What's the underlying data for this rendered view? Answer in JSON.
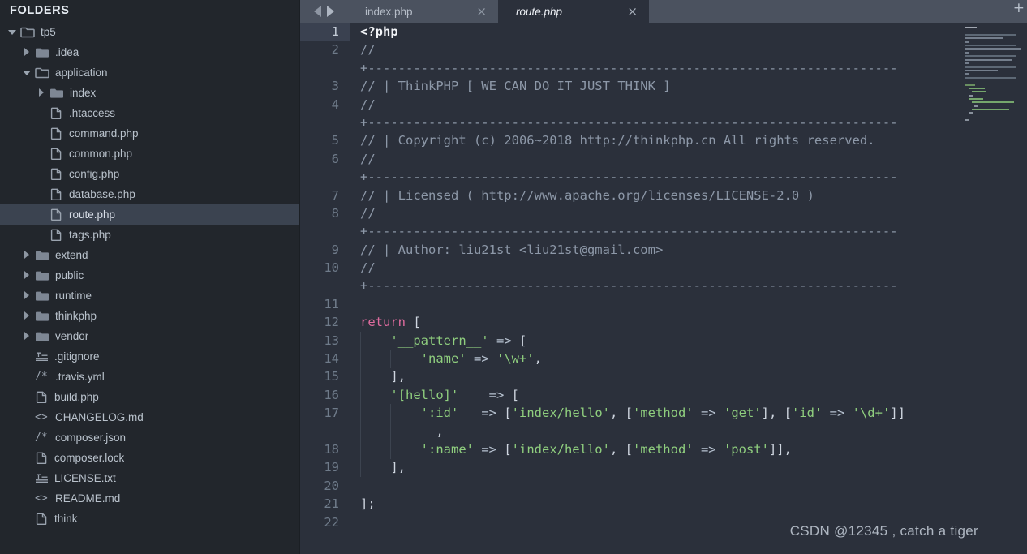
{
  "sidebar": {
    "title": "FOLDERS",
    "items": [
      {
        "label": "tp5",
        "depth": 0,
        "type": "folder-open",
        "state": "open",
        "selected": false
      },
      {
        "label": ".idea",
        "depth": 1,
        "type": "folder-closed",
        "state": "closed",
        "selected": false
      },
      {
        "label": "application",
        "depth": 1,
        "type": "folder-open",
        "state": "open",
        "selected": false
      },
      {
        "label": "index",
        "depth": 2,
        "type": "folder-closed",
        "state": "closed",
        "selected": false
      },
      {
        "label": ".htaccess",
        "depth": 2,
        "type": "file-doc",
        "state": "none",
        "selected": false
      },
      {
        "label": "command.php",
        "depth": 2,
        "type": "file-doc",
        "state": "none",
        "selected": false
      },
      {
        "label": "common.php",
        "depth": 2,
        "type": "file-doc",
        "state": "none",
        "selected": false
      },
      {
        "label": "config.php",
        "depth": 2,
        "type": "file-doc",
        "state": "none",
        "selected": false
      },
      {
        "label": "database.php",
        "depth": 2,
        "type": "file-doc",
        "state": "none",
        "selected": false
      },
      {
        "label": "route.php",
        "depth": 2,
        "type": "file-doc",
        "state": "none",
        "selected": true
      },
      {
        "label": "tags.php",
        "depth": 2,
        "type": "file-doc",
        "state": "none",
        "selected": false
      },
      {
        "label": "extend",
        "depth": 1,
        "type": "folder-closed",
        "state": "closed",
        "selected": false
      },
      {
        "label": "public",
        "depth": 1,
        "type": "folder-closed",
        "state": "closed",
        "selected": false
      },
      {
        "label": "runtime",
        "depth": 1,
        "type": "folder-closed",
        "state": "closed",
        "selected": false
      },
      {
        "label": "thinkphp",
        "depth": 1,
        "type": "folder-closed",
        "state": "closed",
        "selected": false
      },
      {
        "label": "vendor",
        "depth": 1,
        "type": "folder-closed",
        "state": "closed",
        "selected": false
      },
      {
        "label": ".gitignore",
        "depth": 1,
        "type": "file-text",
        "state": "none",
        "selected": false
      },
      {
        "label": ".travis.yml",
        "depth": 1,
        "type": "file-comment",
        "state": "none",
        "selected": false
      },
      {
        "label": "build.php",
        "depth": 1,
        "type": "file-doc",
        "state": "none",
        "selected": false
      },
      {
        "label": "CHANGELOG.md",
        "depth": 1,
        "type": "file-markup",
        "state": "none",
        "selected": false
      },
      {
        "label": "composer.json",
        "depth": 1,
        "type": "file-comment",
        "state": "none",
        "selected": false
      },
      {
        "label": "composer.lock",
        "depth": 1,
        "type": "file-doc",
        "state": "none",
        "selected": false
      },
      {
        "label": "LICENSE.txt",
        "depth": 1,
        "type": "file-text",
        "state": "none",
        "selected": false
      },
      {
        "label": "README.md",
        "depth": 1,
        "type": "file-markup",
        "state": "none",
        "selected": false
      },
      {
        "label": "think",
        "depth": 1,
        "type": "file-doc",
        "state": "none",
        "selected": false
      }
    ]
  },
  "tabbar": {
    "nav_prev_icon": "triangle-left-icon",
    "nav_next_icon": "triangle-right-icon",
    "new_tab_label": "+",
    "close_glyph": "×",
    "tabs": [
      {
        "label": "index.php",
        "active": false
      },
      {
        "label": "route.php",
        "active": true
      }
    ]
  },
  "editor": {
    "active_line": 1,
    "watermark": "CSDN @12345 , catch a tiger",
    "rows": [
      {
        "num": "1",
        "active": true,
        "indent": 0,
        "tokens": [
          {
            "t": "tag",
            "v": "<?php"
          }
        ]
      },
      {
        "num": "2",
        "active": false,
        "indent": 0,
        "tokens": [
          {
            "t": "com",
            "v": "//"
          }
        ]
      },
      {
        "num": "",
        "active": false,
        "indent": 0,
        "tokens": [
          {
            "t": "com",
            "v": "+----------------------------------------------------------------------"
          }
        ]
      },
      {
        "num": "3",
        "active": false,
        "indent": 0,
        "tokens": [
          {
            "t": "com",
            "v": "// | ThinkPHP [ WE CAN DO IT JUST THINK ]"
          }
        ]
      },
      {
        "num": "4",
        "active": false,
        "indent": 0,
        "tokens": [
          {
            "t": "com",
            "v": "//"
          }
        ]
      },
      {
        "num": "",
        "active": false,
        "indent": 0,
        "tokens": [
          {
            "t": "com",
            "v": "+----------------------------------------------------------------------"
          }
        ]
      },
      {
        "num": "5",
        "active": false,
        "indent": 0,
        "tokens": [
          {
            "t": "com",
            "v": "// | Copyright (c) 2006~2018 http://thinkphp.cn All rights reserved."
          }
        ]
      },
      {
        "num": "6",
        "active": false,
        "indent": 0,
        "tokens": [
          {
            "t": "com",
            "v": "//"
          }
        ]
      },
      {
        "num": "",
        "active": false,
        "indent": 0,
        "tokens": [
          {
            "t": "com",
            "v": "+----------------------------------------------------------------------"
          }
        ]
      },
      {
        "num": "7",
        "active": false,
        "indent": 0,
        "tokens": [
          {
            "t": "com",
            "v": "// | Licensed ( http://www.apache.org/licenses/LICENSE-2.0 )"
          }
        ]
      },
      {
        "num": "8",
        "active": false,
        "indent": 0,
        "tokens": [
          {
            "t": "com",
            "v": "//"
          }
        ]
      },
      {
        "num": "",
        "active": false,
        "indent": 0,
        "tokens": [
          {
            "t": "com",
            "v": "+----------------------------------------------------------------------"
          }
        ]
      },
      {
        "num": "9",
        "active": false,
        "indent": 0,
        "tokens": [
          {
            "t": "com",
            "v": "// | Author: liu21st <liu21st@gmail.com>"
          }
        ]
      },
      {
        "num": "10",
        "active": false,
        "indent": 0,
        "tokens": [
          {
            "t": "com",
            "v": "//"
          }
        ]
      },
      {
        "num": "",
        "active": false,
        "indent": 0,
        "tokens": [
          {
            "t": "com",
            "v": "+----------------------------------------------------------------------"
          }
        ]
      },
      {
        "num": "11",
        "active": false,
        "indent": 0,
        "tokens": []
      },
      {
        "num": "12",
        "active": false,
        "indent": 0,
        "tokens": [
          {
            "t": "kw",
            "v": "return"
          },
          {
            "t": "pun",
            "v": " ["
          }
        ]
      },
      {
        "num": "13",
        "active": false,
        "indent": 1,
        "tokens": [
          {
            "t": "pun",
            "v": "    "
          },
          {
            "t": "str",
            "v": "'__pattern__'"
          },
          {
            "t": "op",
            "v": " => "
          },
          {
            "t": "pun",
            "v": "["
          }
        ]
      },
      {
        "num": "14",
        "active": false,
        "indent": 2,
        "tokens": [
          {
            "t": "pun",
            "v": "        "
          },
          {
            "t": "str",
            "v": "'name'"
          },
          {
            "t": "op",
            "v": " => "
          },
          {
            "t": "str",
            "v": "'\\w+'"
          },
          {
            "t": "pun",
            "v": ","
          }
        ]
      },
      {
        "num": "15",
        "active": false,
        "indent": 1,
        "tokens": [
          {
            "t": "pun",
            "v": "    ],"
          }
        ]
      },
      {
        "num": "16",
        "active": false,
        "indent": 1,
        "tokens": [
          {
            "t": "pun",
            "v": "    "
          },
          {
            "t": "str",
            "v": "'[hello]'"
          },
          {
            "t": "op",
            "v": "    => "
          },
          {
            "t": "pun",
            "v": "["
          }
        ]
      },
      {
        "num": "17",
        "active": false,
        "indent": 2,
        "tokens": [
          {
            "t": "pun",
            "v": "        "
          },
          {
            "t": "str",
            "v": "':id'"
          },
          {
            "t": "op",
            "v": "   => "
          },
          {
            "t": "pun",
            "v": "["
          },
          {
            "t": "str",
            "v": "'index/hello'"
          },
          {
            "t": "pun",
            "v": ", ["
          },
          {
            "t": "str",
            "v": "'method'"
          },
          {
            "t": "op",
            "v": " => "
          },
          {
            "t": "str",
            "v": "'get'"
          },
          {
            "t": "pun",
            "v": "], ["
          },
          {
            "t": "str",
            "v": "'id'"
          },
          {
            "t": "op",
            "v": " => "
          },
          {
            "t": "str",
            "v": "'\\d+'"
          },
          {
            "t": "pun",
            "v": "]]"
          }
        ]
      },
      {
        "num": "",
        "active": false,
        "indent": 2,
        "tokens": [
          {
            "t": "pun",
            "v": "          ,"
          }
        ]
      },
      {
        "num": "18",
        "active": false,
        "indent": 2,
        "tokens": [
          {
            "t": "pun",
            "v": "        "
          },
          {
            "t": "str",
            "v": "':name'"
          },
          {
            "t": "op",
            "v": " => "
          },
          {
            "t": "pun",
            "v": "["
          },
          {
            "t": "str",
            "v": "'index/hello'"
          },
          {
            "t": "pun",
            "v": ", ["
          },
          {
            "t": "str",
            "v": "'method'"
          },
          {
            "t": "op",
            "v": " => "
          },
          {
            "t": "str",
            "v": "'post'"
          },
          {
            "t": "pun",
            "v": "]],"
          }
        ]
      },
      {
        "num": "19",
        "active": false,
        "indent": 1,
        "tokens": [
          {
            "t": "pun",
            "v": "    ],"
          }
        ]
      },
      {
        "num": "20",
        "active": false,
        "indent": 0,
        "tokens": []
      },
      {
        "num": "21",
        "active": false,
        "indent": 0,
        "tokens": [
          {
            "t": "pun",
            "v": "];"
          }
        ]
      },
      {
        "num": "22",
        "active": false,
        "indent": 0,
        "tokens": []
      }
    ]
  },
  "minimap": {
    "lines": [
      {
        "w": 14,
        "x": 0,
        "c": "#c9cfd9"
      },
      {
        "w": 0,
        "x": 0,
        "c": "#6f7b8a"
      },
      {
        "w": 62,
        "x": 0,
        "c": "#6f7b8a"
      },
      {
        "w": 46,
        "x": 0,
        "c": "#8d98a8"
      },
      {
        "w": 5,
        "x": 0,
        "c": "#8d98a8"
      },
      {
        "w": 62,
        "x": 0,
        "c": "#6f7b8a"
      },
      {
        "w": 68,
        "x": 0,
        "c": "#8d98a8"
      },
      {
        "w": 5,
        "x": 0,
        "c": "#8d98a8"
      },
      {
        "w": 62,
        "x": 0,
        "c": "#6f7b8a"
      },
      {
        "w": 58,
        "x": 0,
        "c": "#8d98a8"
      },
      {
        "w": 5,
        "x": 0,
        "c": "#8d98a8"
      },
      {
        "w": 62,
        "x": 0,
        "c": "#6f7b8a"
      },
      {
        "w": 40,
        "x": 0,
        "c": "#8d98a8"
      },
      {
        "w": 5,
        "x": 0,
        "c": "#8d98a8"
      },
      {
        "w": 62,
        "x": 0,
        "c": "#6f7b8a"
      },
      {
        "w": 0,
        "x": 0,
        "c": "#6f7b8a"
      },
      {
        "w": 12,
        "x": 0,
        "c": "#7fae6e"
      },
      {
        "w": 20,
        "x": 4,
        "c": "#8fce7e"
      },
      {
        "w": 17,
        "x": 8,
        "c": "#8fce7e"
      },
      {
        "w": 5,
        "x": 4,
        "c": "#aab2be"
      },
      {
        "w": 18,
        "x": 4,
        "c": "#8fce7e"
      },
      {
        "w": 52,
        "x": 8,
        "c": "#8fce7e"
      },
      {
        "w": 4,
        "x": 11,
        "c": "#aab2be"
      },
      {
        "w": 46,
        "x": 8,
        "c": "#8fce7e"
      },
      {
        "w": 6,
        "x": 4,
        "c": "#aab2be"
      },
      {
        "w": 0,
        "x": 0,
        "c": "#aab2be"
      },
      {
        "w": 4,
        "x": 0,
        "c": "#aab2be"
      }
    ]
  }
}
